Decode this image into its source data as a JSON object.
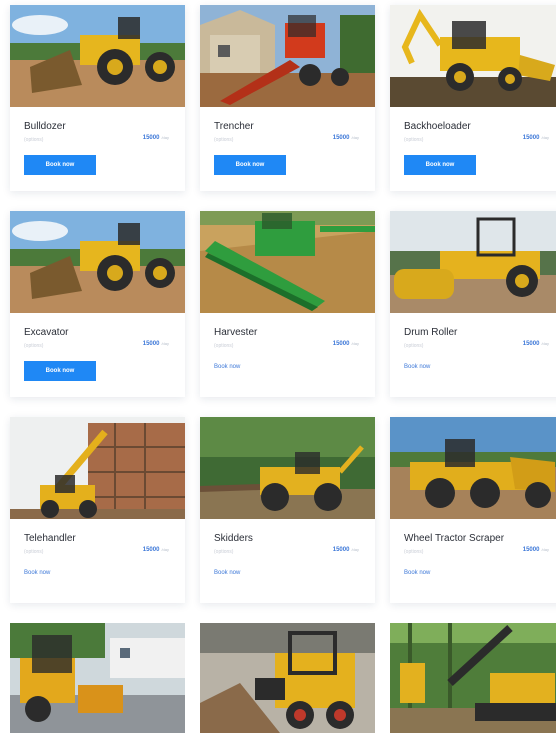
{
  "listings": [
    {
      "name": "Bulldozer",
      "sub": "(options)",
      "price": "15000",
      "unit": "/day",
      "action": "Book now"
    },
    {
      "name": "Trencher",
      "sub": "(options)",
      "price": "15000",
      "unit": "/day",
      "action": "Book now"
    },
    {
      "name": "Backhoeloader",
      "sub": "(options)",
      "price": "15000",
      "unit": "/day",
      "action": "Book now"
    },
    {
      "name": "Excavator",
      "sub": "(options)",
      "price": "15000",
      "unit": "/day",
      "action": "Book now"
    },
    {
      "name": "Harvester",
      "sub": "(options)",
      "price": "15000",
      "unit": "/day",
      "action": "Book now"
    },
    {
      "name": "Drum Roller",
      "sub": "(options)",
      "price": "15000",
      "unit": "/day",
      "action": "Book now"
    },
    {
      "name": "Telehandler",
      "sub": "(options)",
      "price": "15000",
      "unit": "/day",
      "action": "Book now"
    },
    {
      "name": "Skidders",
      "sub": "(options)",
      "price": "15000",
      "unit": "/day",
      "action": "Book now"
    },
    {
      "name": "Wheel Tractor Scraper",
      "sub": "(options)",
      "price": "15000",
      "unit": "/day",
      "action": "Book now"
    }
  ],
  "colors": {
    "accent": "#1f88f5",
    "link": "#3d78d8",
    "title": "#2b2f38"
  }
}
